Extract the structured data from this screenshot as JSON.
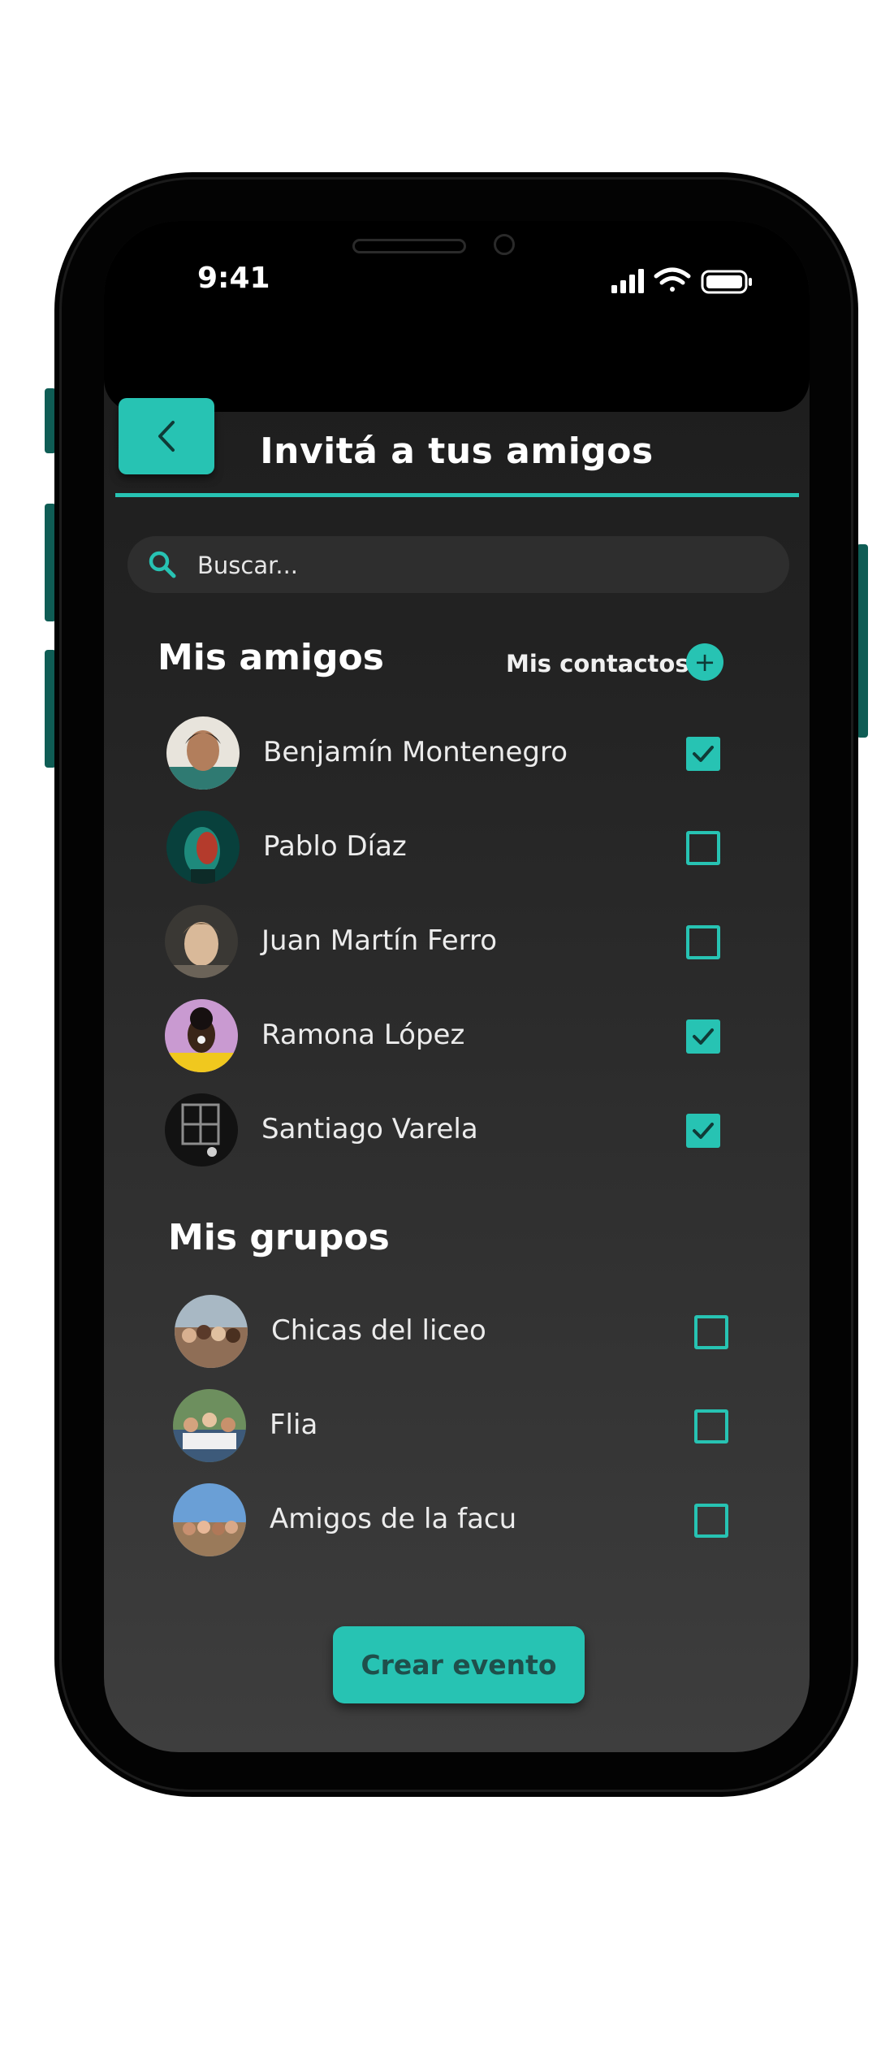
{
  "status_bar": {
    "time": "9:41"
  },
  "header": {
    "title": "Invitá a tus amigos",
    "back_icon": "chevron-left-icon"
  },
  "search": {
    "placeholder": "Buscar...",
    "icon": "search-icon"
  },
  "friends_section": {
    "title": "Mis amigos",
    "contacts_label": "Mis contactos",
    "add_symbol": "+",
    "items": [
      {
        "name": "Benjamín Montenegro",
        "checked": true
      },
      {
        "name": "Pablo Díaz",
        "checked": false
      },
      {
        "name": "Juan Martín Ferro",
        "checked": false
      },
      {
        "name": "Ramona López",
        "checked": true
      },
      {
        "name": "Santiago Varela",
        "checked": true
      }
    ]
  },
  "groups_section": {
    "title": "Mis grupos",
    "items": [
      {
        "name": "Chicas del liceo",
        "checked": false
      },
      {
        "name": "Flia",
        "checked": false
      },
      {
        "name": "Amigos de la facu",
        "checked": false
      }
    ]
  },
  "create_button": {
    "label": "Crear evento"
  },
  "colors": {
    "accent": "#27c3b3",
    "background_top": "#1b1b1b",
    "background_bottom": "#3e3e3e"
  }
}
